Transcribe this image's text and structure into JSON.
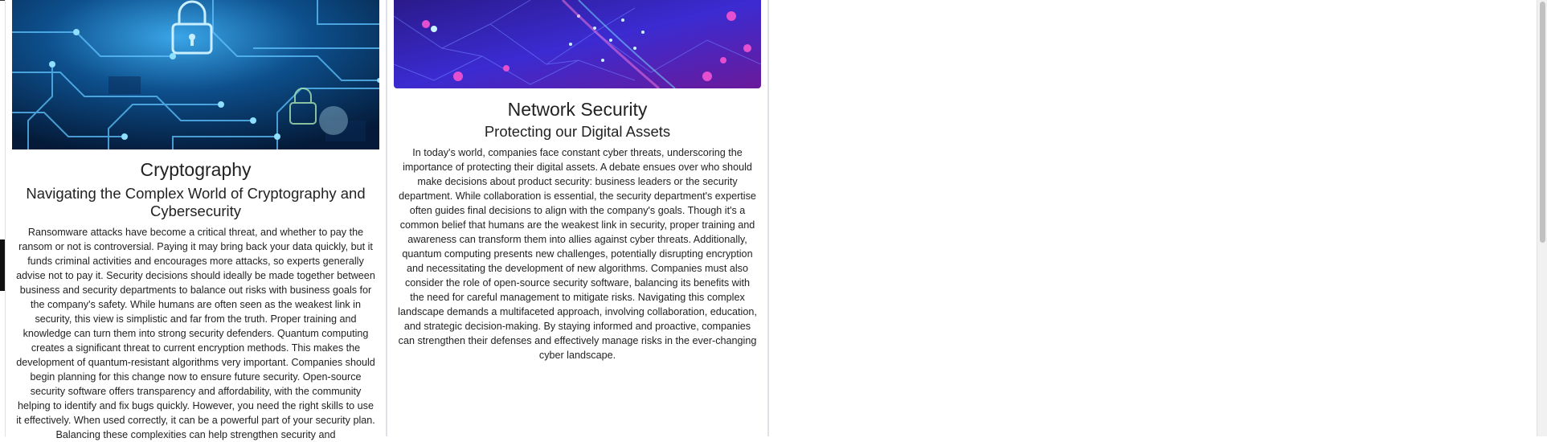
{
  "cards": [
    {
      "image_alt": "circuit board with padlock icons",
      "title": "Cryptography",
      "subtitle": "Navigating the Complex World of Cryptography and Cybersecurity",
      "body": "Ransomware attacks have become a critical threat, and whether to pay the ransom or not is controversial. Paying it may bring back your data quickly, but it funds criminal activities and encourages more attacks, so experts generally advise not to pay it. Security decisions should ideally be made together between business and security departments to balance out risks with business goals for the company's safety. While humans are often seen as the weakest link in security, this view is simplistic and far from the truth. Proper training and knowledge can turn them into strong security defenders. Quantum computing creates a significant threat to current encryption methods. This makes the development of quantum-resistant algorithms very important. Companies should begin planning for this change now to ensure future security. Open-source security software offers transparency and affordability, with the community helping to identify and fix bugs quickly. However, you need the right skills to use it effectively. When used correctly, it can be a powerful part of your security plan. Balancing these complexities can help strengthen security and"
    },
    {
      "image_alt": "abstract network of glowing particles",
      "title": "Network Security",
      "subtitle": "Protecting our Digital Assets",
      "body": "In today's world, companies face constant cyber threats, underscoring the importance of protecting their digital assets. A debate ensues over who should make decisions about product security: business leaders or the security department. While collaboration is essential, the security department's expertise often guides final decisions to align with the company's goals. Though it's a common belief that humans are the weakest link in security, proper training and awareness can transform them into allies against cyber threats. Additionally, quantum computing presents new challenges, potentially disrupting encryption and necessitating the development of new algorithms. Companies must also consider the role of open-source security software, balancing its benefits with the need for careful management to mitigate risks. Navigating this complex landscape demands a multifaceted approach, involving collaboration, education, and strategic decision-making. By staying informed and proactive, companies can strengthen their defenses and effectively manage risks in the ever-changing cyber landscape."
    }
  ]
}
